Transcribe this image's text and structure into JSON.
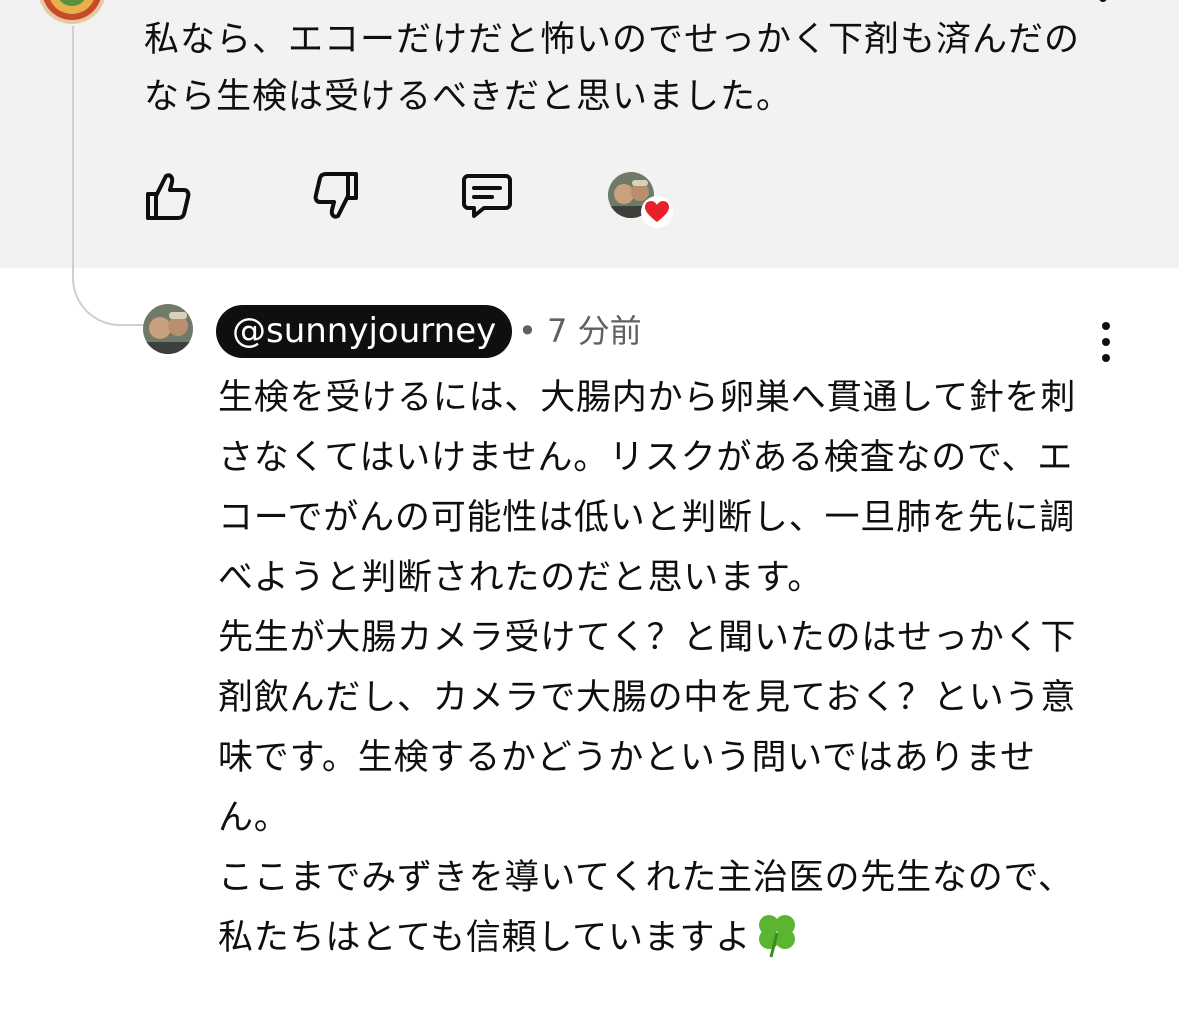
{
  "parent_comment": {
    "text": "私なら、エコーだけだと怖いのでせっかく下剤も済んだのなら生検は受けるべきだと思いました。",
    "actions": {
      "like_icon": "thumbs-up-icon",
      "dislike_icon": "thumbs-down-icon",
      "reply_icon": "reply-comment-icon",
      "creator_heart_icon": "creator-heart-icon"
    }
  },
  "reply": {
    "handle": "@sunnyjourney",
    "meta": "• 7 分前",
    "paragraphs": [
      "生検を受けるには、大腸内から卵巣へ貫通して針を刺さなくてはいけません。リスクがある検査なので、エコーでがんの可能性は低いと判断し、一旦肺を先に調べようと判断されたのだと思います。",
      "先生が大腸カメラ受けてく？と聞いたのはせっかく下剤飲んだし、カメラで大腸の中を見ておく？という意味です。生検するかどうかという問いではありません。",
      "ここまでみずきを導いてくれた主治医の先生なので、私たちはとても信頼していますよ"
    ],
    "trailing_emoji": "four-leaf-clover-icon"
  },
  "colors": {
    "top_background": "#f2f2f2",
    "handle_pill": "#0f0f0f",
    "heart": "#e8202b",
    "clover": "#5cb531",
    "meta_text": "#606060"
  }
}
